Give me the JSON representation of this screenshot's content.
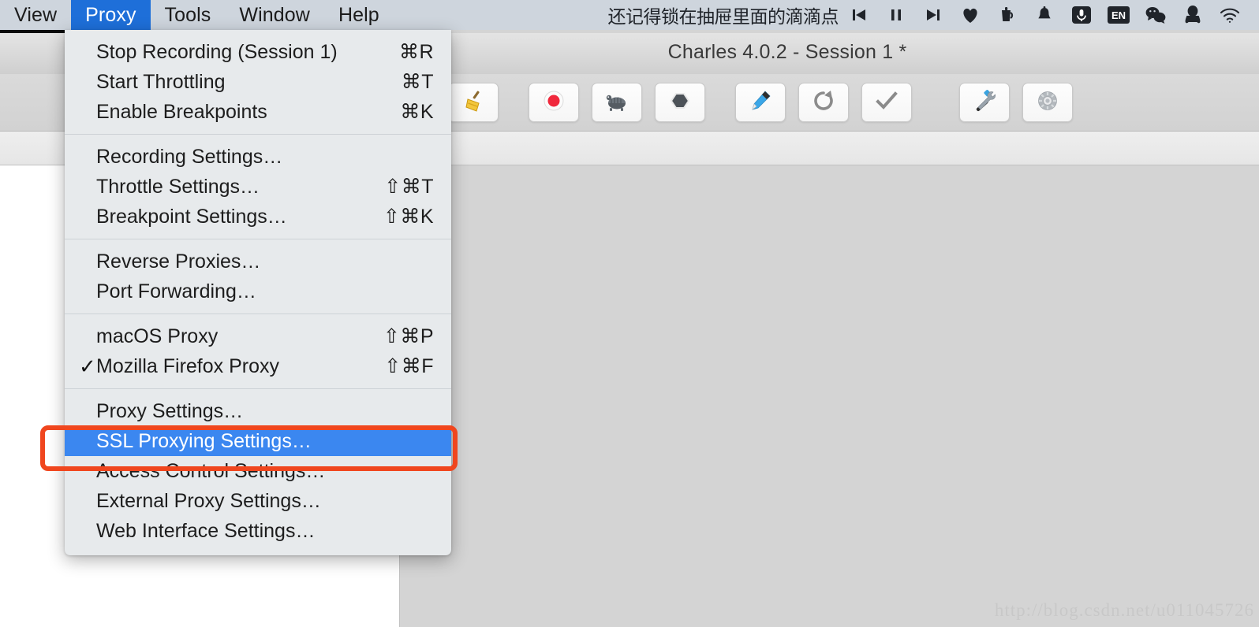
{
  "menubar": {
    "items": [
      {
        "label": "View",
        "active": false
      },
      {
        "label": "Proxy",
        "active": true
      },
      {
        "label": "Tools",
        "active": false
      },
      {
        "label": "Window",
        "active": false
      },
      {
        "label": "Help",
        "active": false
      }
    ],
    "status_text": "还记得锁在抽屉里面的滴滴点",
    "status_icons": [
      "previous-track-icon",
      "pause-icon",
      "next-track-icon",
      "heart-icon",
      "coffee-pot-icon",
      "bell-icon",
      "microphone-icon",
      "input-language-en-icon",
      "wechat-icon",
      "qq-penguin-icon",
      "wifi-icon"
    ],
    "input_language_label": "EN",
    "highlight_color": "#1e6fd9"
  },
  "window": {
    "title": "Charles 4.0.2 - Session 1 *",
    "watermark": "http://blog.csdn.net/u011045726"
  },
  "toolbar": {
    "buttons": [
      {
        "name": "clear-button",
        "icon": "broom-icon"
      },
      {
        "name": "record-button",
        "icon": "record-red-dot-icon"
      },
      {
        "name": "throttle-button",
        "icon": "turtle-icon"
      },
      {
        "name": "breakpoints-button",
        "icon": "hexagon-icon"
      },
      {
        "name": "compose-button",
        "icon": "pen-icon"
      },
      {
        "name": "repeat-button",
        "icon": "refresh-arrow-icon"
      },
      {
        "name": "validate-button",
        "icon": "checkmark-icon"
      },
      {
        "name": "tools-button",
        "icon": "hammer-wrench-icon"
      },
      {
        "name": "settings-button",
        "icon": "gear-icon"
      }
    ]
  },
  "proxy_menu": {
    "groups": [
      {
        "items": [
          {
            "label": "Stop Recording (Session 1)",
            "shortcut": "⌘R",
            "checked": false,
            "selected": false
          },
          {
            "label": "Start Throttling",
            "shortcut": "⌘T",
            "checked": false,
            "selected": false
          },
          {
            "label": "Enable Breakpoints",
            "shortcut": "⌘K",
            "checked": false,
            "selected": false
          }
        ]
      },
      {
        "items": [
          {
            "label": "Recording Settings…",
            "shortcut": "",
            "checked": false,
            "selected": false
          },
          {
            "label": "Throttle Settings…",
            "shortcut": "⇧⌘T",
            "checked": false,
            "selected": false
          },
          {
            "label": "Breakpoint Settings…",
            "shortcut": "⇧⌘K",
            "checked": false,
            "selected": false
          }
        ]
      },
      {
        "items": [
          {
            "label": "Reverse Proxies…",
            "shortcut": "",
            "checked": false,
            "selected": false
          },
          {
            "label": "Port Forwarding…",
            "shortcut": "",
            "checked": false,
            "selected": false
          }
        ]
      },
      {
        "items": [
          {
            "label": "macOS Proxy",
            "shortcut": "⇧⌘P",
            "checked": false,
            "selected": false
          },
          {
            "label": "Mozilla Firefox Proxy",
            "shortcut": "⇧⌘F",
            "checked": true,
            "selected": false
          }
        ]
      },
      {
        "items": [
          {
            "label": "Proxy Settings…",
            "shortcut": "",
            "checked": false,
            "selected": false
          },
          {
            "label": "SSL Proxying Settings…",
            "shortcut": "",
            "checked": false,
            "selected": true
          },
          {
            "label": "Access Control Settings…",
            "shortcut": "",
            "checked": false,
            "selected": false
          },
          {
            "label": "External Proxy Settings…",
            "shortcut": "",
            "checked": false,
            "selected": false
          },
          {
            "label": "Web Interface Settings…",
            "shortcut": "",
            "checked": false,
            "selected": false
          }
        ]
      }
    ],
    "selected_item_color": "#3b87f0",
    "check_glyph": "✓"
  },
  "annotation": {
    "name": "ssl-proxying-settings-highlight",
    "color": "#f0461e"
  }
}
